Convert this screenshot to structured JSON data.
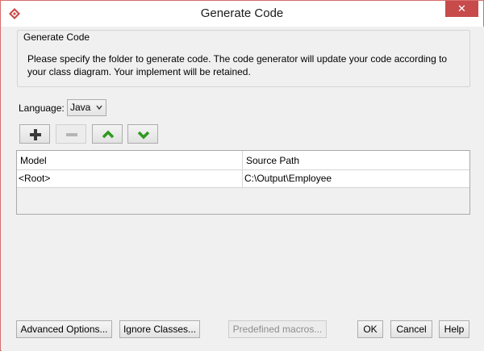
{
  "window": {
    "title": "Generate Code",
    "close_label": "✕"
  },
  "group": {
    "legend": "Generate Code",
    "description": "Please specify the folder to generate code. The code generator will update your code according to your class diagram. Your implement will be retained."
  },
  "language": {
    "label": "Language:",
    "selected": "Java"
  },
  "table": {
    "columns": [
      "Model",
      "Source Path"
    ],
    "rows": [
      {
        "model": "<Root>",
        "source_path": "C:\\Output\\Employee"
      }
    ]
  },
  "buttons": {
    "advanced": "Advanced Options...",
    "ignore": "Ignore Classes...",
    "macros": "Predefined macros...",
    "ok": "OK",
    "cancel": "Cancel",
    "help": "Help"
  },
  "colors": {
    "accent_green": "#2e9a1f",
    "close_red": "#c74b4b"
  }
}
